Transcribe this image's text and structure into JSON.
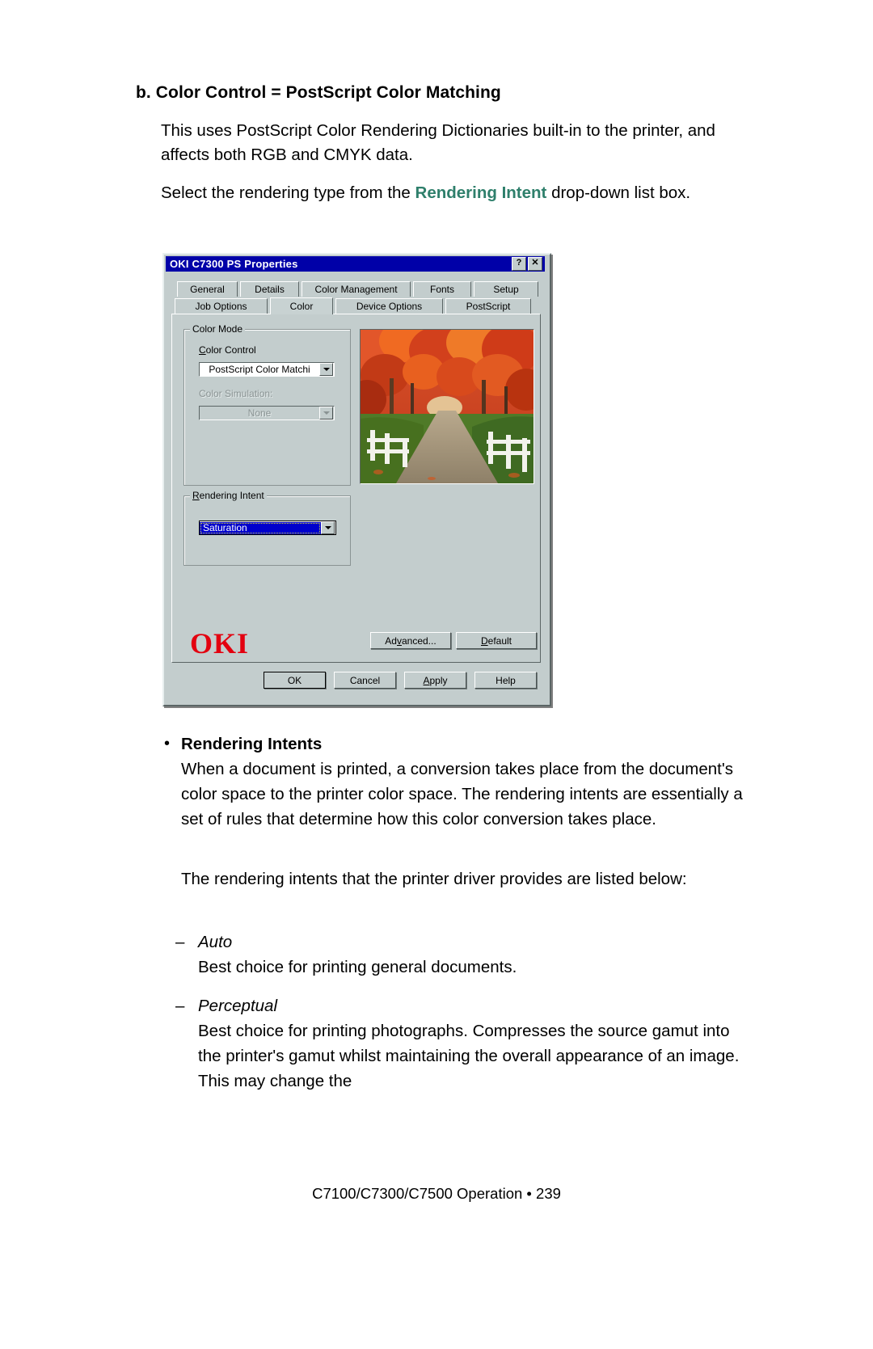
{
  "page": {
    "heading": "b. Color Control = PostScript Color Matching",
    "para1": "This uses PostScript Color Rendering Dictionaries built-in to the printer, and affects both RGB and CMYK data.",
    "para2_before": "Select the rendering type from the ",
    "para2_accent": "Rendering Intent",
    "para2_after": " drop-down list box.",
    "bullet_dot": "•",
    "bullet_title": "Rendering Intents",
    "bullet_body": "When a document is printed, a conversion takes place from the document's color space to the printer color space. The rendering intents are essentially a set of rules that determine how this color conversion takes place.",
    "para3": "The rendering intents that the printer driver provides are listed below:",
    "dash_mark": "–",
    "items": [
      {
        "term": "Auto",
        "definition": "Best choice for printing general documents."
      },
      {
        "term": "Perceptual",
        "definition": "Best choice for printing photographs. Compresses the source gamut into the printer's gamut whilst maintaining the overall appearance of an image. This may change the"
      }
    ],
    "footer": "C7100/C7300/C7500  Operation • 239"
  },
  "dialog": {
    "title": "OKI C7300 PS Properties",
    "titlebar_buttons": [
      {
        "name": "help",
        "glyph": "?"
      },
      {
        "name": "close",
        "glyph": "✕"
      }
    ],
    "tabs_row1": [
      {
        "label": "General",
        "active": false
      },
      {
        "label": "Details",
        "active": false
      },
      {
        "label": "Color Management",
        "active": false
      },
      {
        "label": "Fonts",
        "active": false
      },
      {
        "label": "Setup",
        "active": false
      }
    ],
    "tabs_row2": [
      {
        "label": "Job Options",
        "active": false
      },
      {
        "label": "Color",
        "active": true
      },
      {
        "label": "Device Options",
        "active": false
      },
      {
        "label": "PostScript",
        "active": false
      }
    ],
    "color_mode": {
      "group_label": "Color Mode",
      "color_control_label": "Color Control",
      "color_control_value": "PostScript Color Matchi",
      "color_simulation_label": "Color Simulation:",
      "color_simulation_value": "None"
    },
    "rendering_intent": {
      "group_label": "Rendering Intent",
      "value": "Saturation"
    },
    "logo_text": "OKI",
    "buttons": {
      "advanced": "Advanced...",
      "default": "Default",
      "ok": "OK",
      "cancel": "Cancel",
      "apply": "Apply",
      "help": "Help"
    },
    "colors": {
      "titlebar": "#0000a8",
      "face": "#c3cdcd",
      "logo": "#e3000f",
      "selection": "#0000cc"
    }
  }
}
